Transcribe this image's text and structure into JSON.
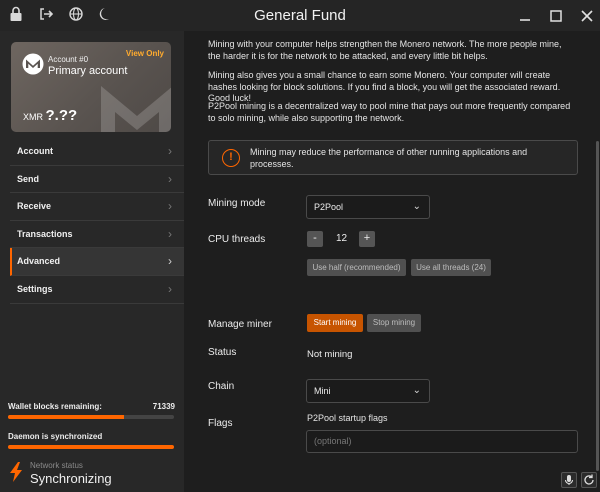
{
  "window": {
    "title": "General Fund",
    "left_icons": [
      "lock-icon",
      "logout-icon",
      "globe-icon",
      "moon-icon"
    ],
    "controls": [
      "minimize",
      "maximize",
      "close"
    ]
  },
  "account_card": {
    "account_number": "Account #0",
    "account_name": "Primary account",
    "badge": "View Only",
    "currency": "XMR",
    "balance": "?.??"
  },
  "sidebar": {
    "items": [
      {
        "label": "Account"
      },
      {
        "label": "Send"
      },
      {
        "label": "Receive"
      },
      {
        "label": "Transactions"
      },
      {
        "label": "Advanced",
        "active": true
      },
      {
        "label": "Settings"
      }
    ],
    "wallet_sync": {
      "label": "Wallet blocks remaining:",
      "value": "71339",
      "progress": 0.7
    },
    "daemon_sync": {
      "label": "Daemon is synchronized",
      "progress": 1.0
    },
    "network": {
      "label": "Network status",
      "status": "Synchronizing"
    }
  },
  "main": {
    "intro_1": "Mining with your computer helps strengthen the Monero network. The more people mine, the harder it is for the network to be attacked, and every little bit helps.",
    "intro_2": "Mining also gives you a small chance to earn some Monero. Your computer will create hashes looking for block solutions. If you find a block, you will get the associated reward. Good luck!",
    "intro_3": "P2Pool mining is a decentralized way to pool mine that pays out more frequently compared to solo mining, while also supporting the network.",
    "warning": "Mining may reduce the performance of other running applications and processes.",
    "mining_mode": {
      "label": "Mining mode",
      "value": "P2Pool"
    },
    "cpu_threads": {
      "label": "CPU threads",
      "value": "12",
      "minus": "-",
      "plus": "+",
      "use_half": "Use half (recommended)",
      "use_all": "Use all threads (24)"
    },
    "manage_miner": {
      "label": "Manage miner",
      "start": "Start mining",
      "stop": "Stop mining"
    },
    "status": {
      "label": "Status",
      "value": "Not mining"
    },
    "chain": {
      "label": "Chain",
      "value": "Mini"
    },
    "flags": {
      "label": "Flags",
      "field_label": "P2Pool startup flags",
      "placeholder": "(optional)"
    }
  }
}
